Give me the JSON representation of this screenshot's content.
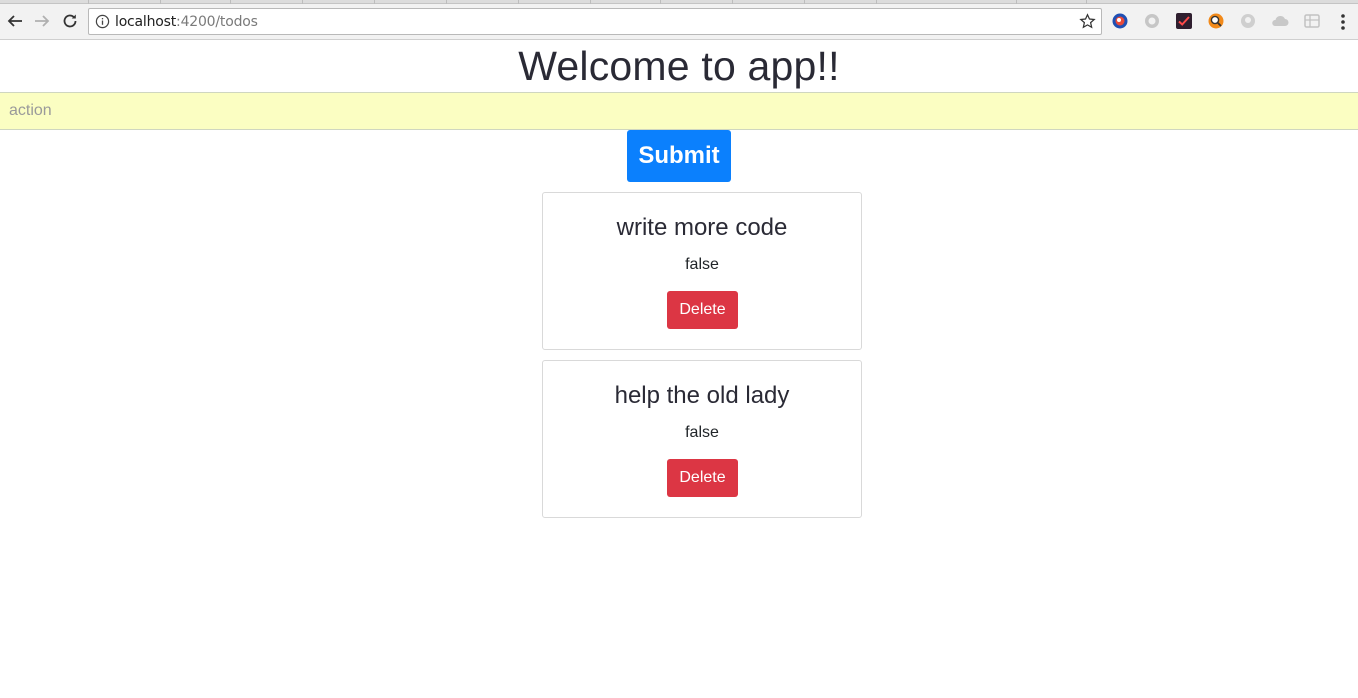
{
  "browser": {
    "url_host": "localhost",
    "url_rest": ":4200/todos",
    "extension_icons": [
      "mascot-extension-icon",
      "circle-extension-icon",
      "checkmark-extension-icon",
      "magnifier-extension-icon",
      "grey-circle-extension-icon",
      "cloud-extension-icon",
      "grid-extension-icon"
    ]
  },
  "page": {
    "title": "Welcome to app!!",
    "input": {
      "placeholder": "action",
      "value": ""
    },
    "submit_label": "Submit"
  },
  "todos": [
    {
      "title": "write more code",
      "status": "false",
      "delete_label": "Delete"
    },
    {
      "title": "help the old lady",
      "status": "false",
      "delete_label": "Delete"
    }
  ],
  "colors": {
    "input_bg": "#fbfec2",
    "primary": "#0b80fd",
    "danger": "#dc3644"
  }
}
